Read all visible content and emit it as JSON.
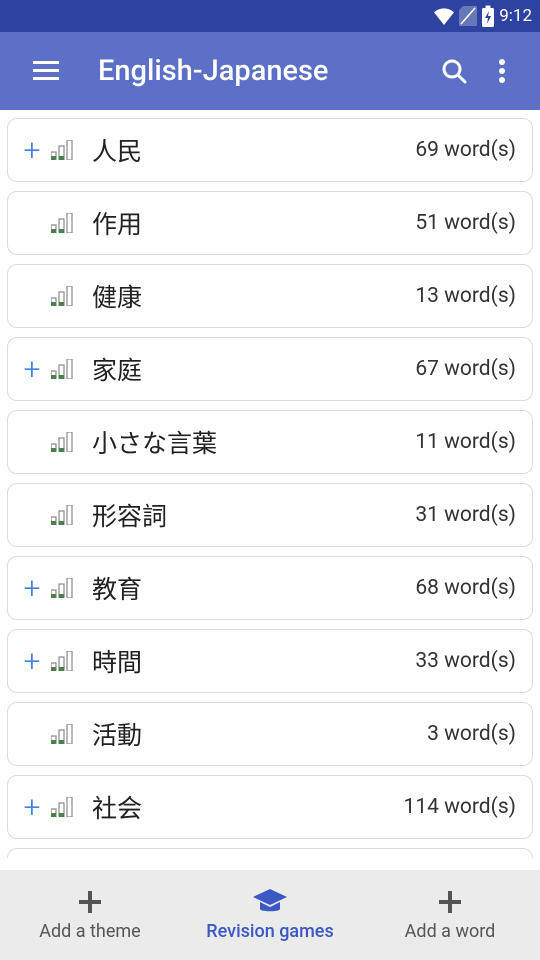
{
  "status": {
    "time": "9:12"
  },
  "header": {
    "title": "English-Japanese"
  },
  "items": [
    {
      "name": "人民",
      "count": "69 word(s)",
      "expandable": true
    },
    {
      "name": "作用",
      "count": "51 word(s)",
      "expandable": false
    },
    {
      "name": "健康",
      "count": "13 word(s)",
      "expandable": false
    },
    {
      "name": "家庭",
      "count": "67 word(s)",
      "expandable": true
    },
    {
      "name": "小さな言葉",
      "count": "11 word(s)",
      "expandable": false
    },
    {
      "name": "形容詞",
      "count": "31 word(s)",
      "expandable": false
    },
    {
      "name": "教育",
      "count": "68 word(s)",
      "expandable": true
    },
    {
      "name": "時間",
      "count": "33 word(s)",
      "expandable": true
    },
    {
      "name": "活動",
      "count": "3 word(s)",
      "expandable": false
    },
    {
      "name": "社会",
      "count": "114 word(s)",
      "expandable": true
    }
  ],
  "nav": {
    "addTheme": "Add a theme",
    "revision": "Revision games",
    "addWord": "Add a word"
  }
}
